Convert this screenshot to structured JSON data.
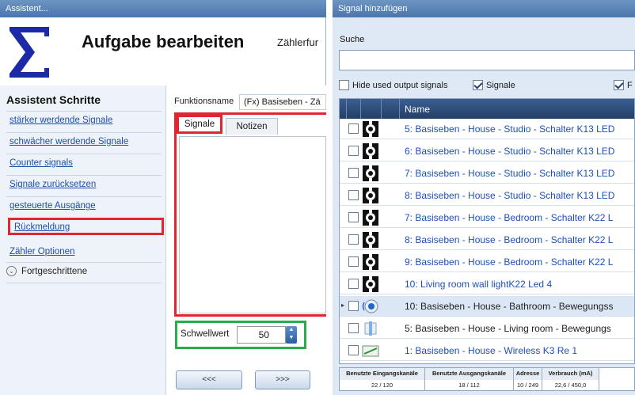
{
  "wizard": {
    "window_title": "Assistent...",
    "title": "Aufgabe bearbeiten",
    "subtitle": "Zählerfur",
    "steps_header": "Assistent Schritte",
    "steps": [
      {
        "label": "stärker werdende Signale"
      },
      {
        "label": "schwächer werdende Signale"
      },
      {
        "label": "Counter signals"
      },
      {
        "label": "Signale zurücksetzen"
      },
      {
        "label": "gesteuerte Ausgänge"
      },
      {
        "label": "Rückmeldung"
      },
      {
        "label": "Zähler Optionen"
      }
    ],
    "advanced_label": "Fortgeschrittene",
    "function_name_label": "Funktionsname",
    "function_name_value": "(Fx) Basiseben - Zä",
    "tabs": {
      "signals": "Signale",
      "notes": "Notizen"
    },
    "threshold_label": "Schwellwert",
    "threshold_value": "50",
    "prev_button": "<<<",
    "next_button": ">>>"
  },
  "signal_dialog": {
    "window_title": "Signal hinzufügen",
    "search_label": "Suche",
    "search_value": "",
    "filters": {
      "hide_used_label": "Hide used output signals",
      "signals_label": "Signale",
      "third_label": "F"
    },
    "column_name": "Name",
    "rows": [
      {
        "label": "5: Basiseben - House - Studio - Schalter K13 LED",
        "style": "link",
        "icon": "led-black"
      },
      {
        "label": "6: Basiseben - House - Studio - Schalter K13 LED",
        "style": "link",
        "icon": "led-black"
      },
      {
        "label": "7: Basiseben - House - Studio - Schalter K13 LED",
        "style": "link",
        "icon": "led-black"
      },
      {
        "label": "8: Basiseben - House - Studio - Schalter K13 LED",
        "style": "link",
        "icon": "led-black"
      },
      {
        "label": "7: Basiseben - House - Bedroom - Schalter K22 L",
        "style": "link",
        "icon": "led-black"
      },
      {
        "label": "8: Basiseben - House - Bedroom - Schalter K22 L",
        "style": "link",
        "icon": "led-black"
      },
      {
        "label": "9: Basiseben - House - Bedroom - Schalter K22 L",
        "style": "link",
        "icon": "led-black"
      },
      {
        "label": "10: Living room wall lightK22 Led 4",
        "style": "link",
        "icon": "led-black"
      },
      {
        "label": "10: Basiseben - House - Bathroom - Bewegungss",
        "style": "plain",
        "icon": "motion-sensor",
        "selected": true
      },
      {
        "label": "5: Basiseben - House - Living room - Bewegungs",
        "style": "plain",
        "icon": "sensor-small"
      },
      {
        "label": "1: Basiseben - House - Wireless K3 Re 1",
        "style": "link",
        "icon": "relay-green"
      }
    ],
    "stats": {
      "input_header": "Benutzte Eingangskanäle",
      "output_header": "Benutzte Ausgangskanäle",
      "address_header": "Adresse",
      "consumption_header": "Verbrauch (mA)",
      "input_value": "22 / 120",
      "output_value": "18 / 112",
      "address_value": "10 / 249",
      "consumption_value": "22,6 / 450,0"
    }
  },
  "colors": {
    "highlight_red": "#e0262e",
    "highlight_green": "#2eaa4a",
    "link_blue": "#1c50b8",
    "title_bar": "#4a76ab",
    "sigma_blue": "#1d2aa8"
  }
}
